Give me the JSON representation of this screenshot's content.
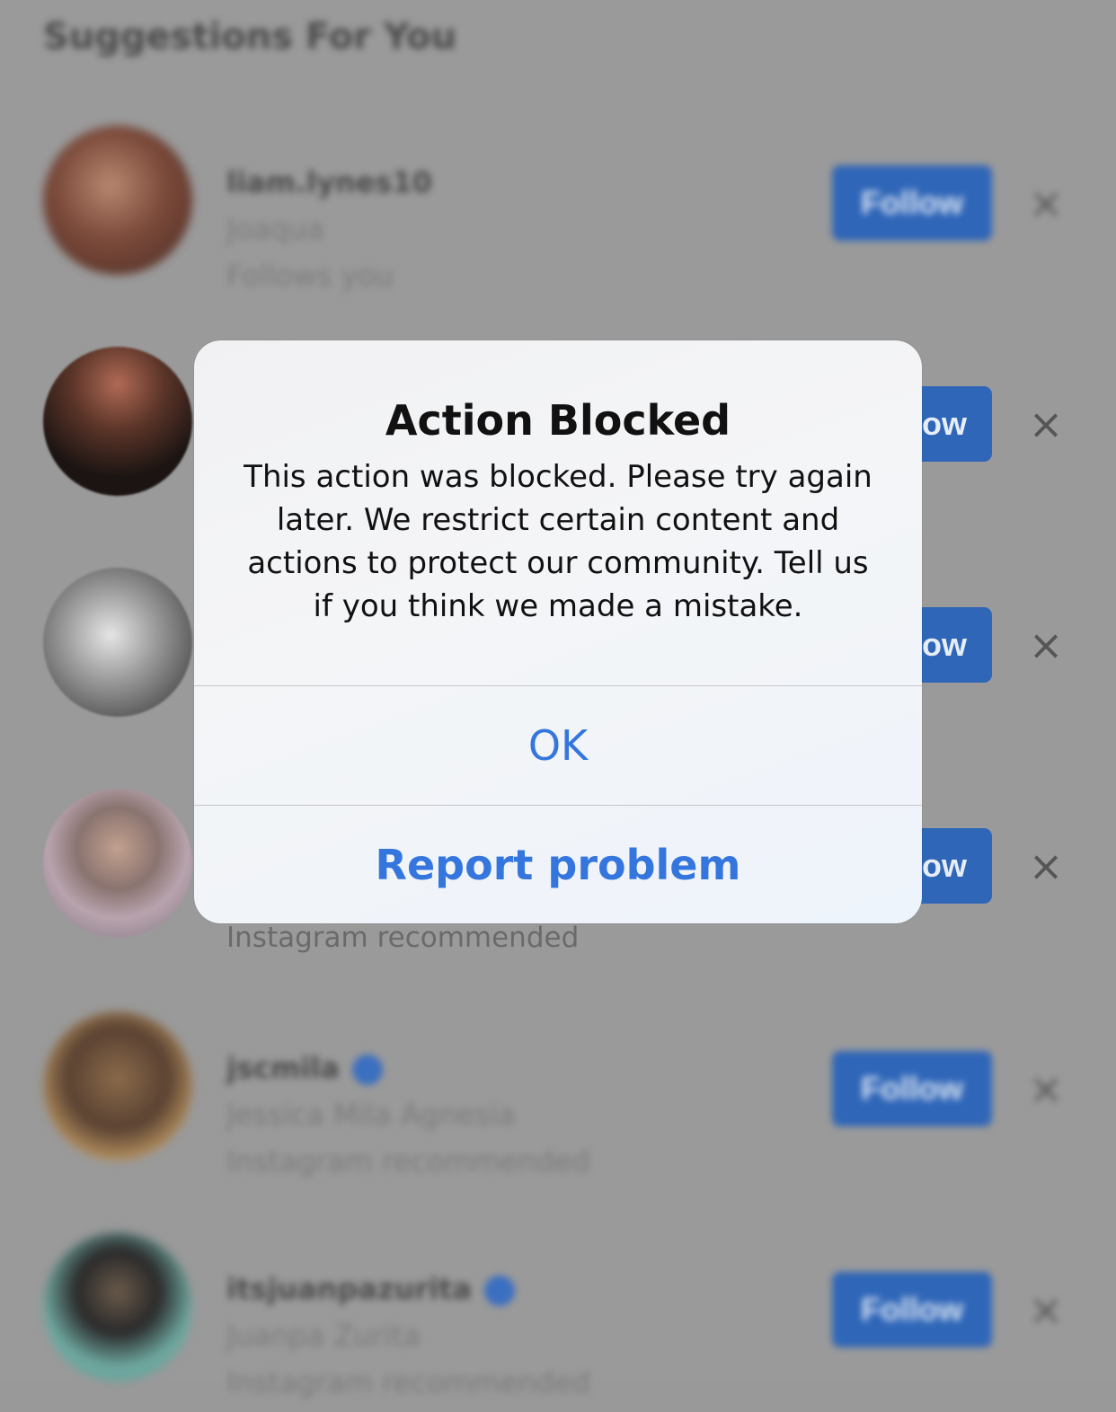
{
  "background": {
    "section_title": "Suggestions For You",
    "suggestions": [
      {
        "username": "liam.lynes10",
        "name": "Joaqua",
        "reason": "Follows you",
        "follow_label": "Follow"
      },
      {
        "follow_label": "ow"
      },
      {
        "follow_label": "ow"
      },
      {
        "follow_label": "ow",
        "reason": "Instagram recommended"
      },
      {
        "username": "jscmila",
        "name": "Jessica Mila Agnesia",
        "reason": "Instagram recommended",
        "follow_label": "Follow"
      },
      {
        "username": "itsjuanpazurita",
        "name": "Juanpa Zurita",
        "reason": "Instagram recommended",
        "follow_label": "Follow"
      }
    ]
  },
  "alert": {
    "title": "Action Blocked",
    "message": "This action was blocked. Please try again later. We restrict certain content and actions to protect our community. Tell us if you think we made a mistake.",
    "ok_label": "OK",
    "report_label": "Report problem"
  },
  "colors": {
    "accent": "#3476de",
    "follow_button": "#2f66b8",
    "dimmed_background": "#9a9a9a"
  },
  "icons": {
    "dismiss": "close-icon",
    "verified": "verified-badge-icon"
  }
}
